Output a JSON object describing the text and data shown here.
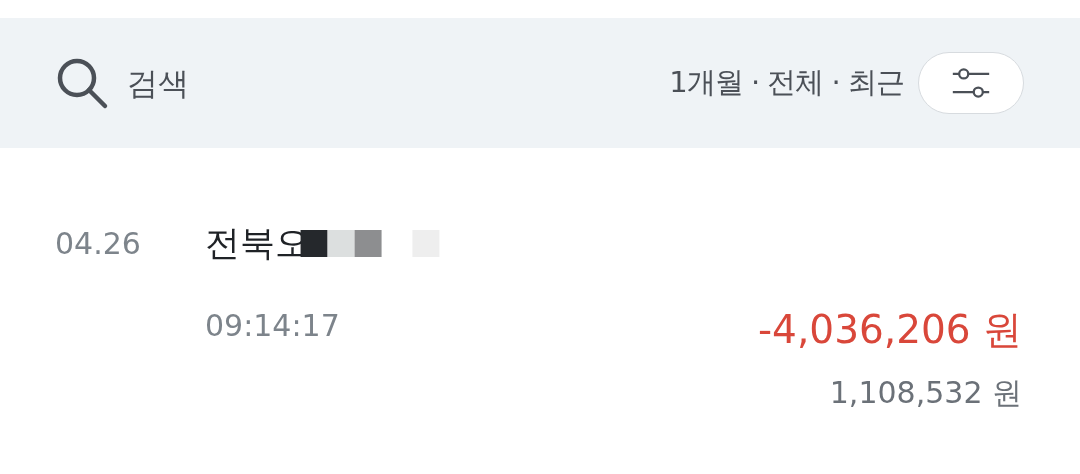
{
  "search": {
    "placeholder": "검색"
  },
  "filter": {
    "summary": "1개월 · 전체 · 최근"
  },
  "transactions": [
    {
      "date": "04.26",
      "name": "전북오",
      "time": "09:14:17",
      "amount": "-4,036,206 원",
      "kind": "withdrawal",
      "balance": "1,108,532 원"
    }
  ]
}
